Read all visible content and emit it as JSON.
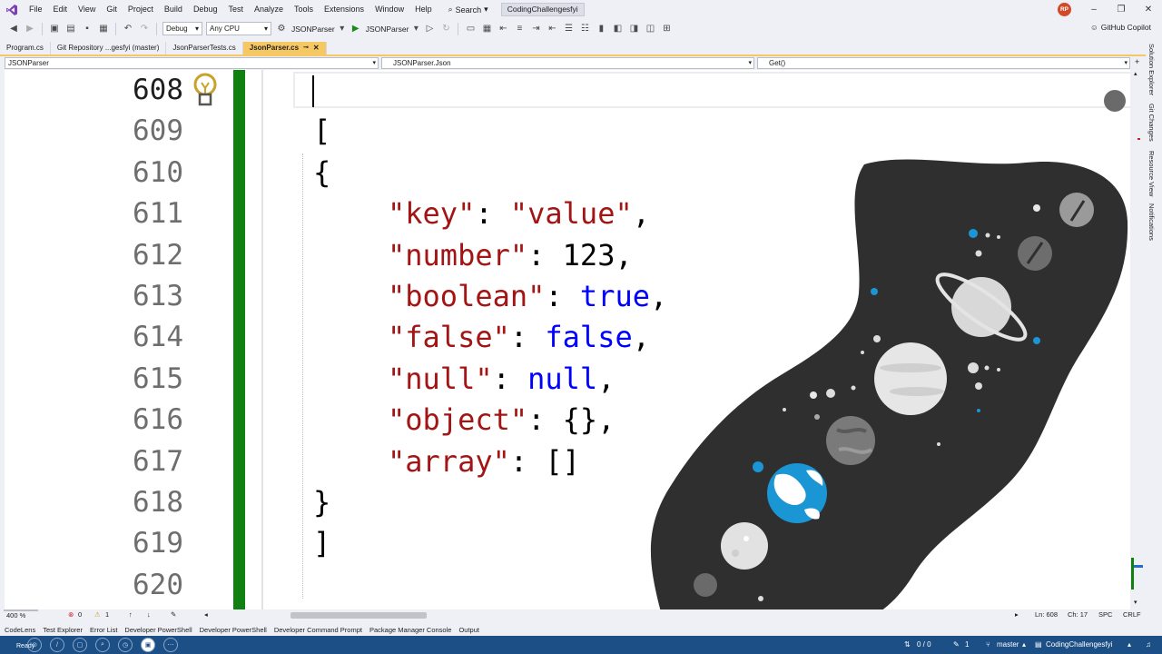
{
  "menu": {
    "items": [
      "File",
      "Edit",
      "View",
      "Git",
      "Project",
      "Build",
      "Debug",
      "Test",
      "Analyze",
      "Tools",
      "Extensions",
      "Window",
      "Help"
    ],
    "search_label": "Search",
    "solution_name": "CodingChallengesfyi",
    "avatar_initials": "RP"
  },
  "toolbar": {
    "config": "Debug",
    "platform": "Any CPU",
    "startup_project": "JSONParser",
    "run_label": "JSONParser",
    "copilot_label": "GitHub Copilot"
  },
  "tabs": [
    {
      "label": "Program.cs",
      "active": false
    },
    {
      "label": "Git Repository ...gesfyi (master)",
      "active": false
    },
    {
      "label": "JsonParserTests.cs",
      "active": false
    },
    {
      "label": "JsonParser.cs",
      "active": true
    }
  ],
  "navbar": {
    "project": "JSONParser",
    "type": "JSONParser.Json",
    "member": "Get()"
  },
  "editor": {
    "line_numbers": [
      "608",
      "609",
      "610",
      "611",
      "612",
      "613",
      "614",
      "615",
      "616",
      "617",
      "618",
      "619",
      "620"
    ],
    "lines": {
      "l609": "[",
      "l610": "{",
      "l611_key": "\"key\"",
      "l611_sep": ": ",
      "l611_val": "\"value\"",
      "l611_end": ",",
      "l612_key": "\"number\"",
      "l612_sep": ": ",
      "l612_val": "123",
      "l612_end": ",",
      "l613_key": "\"boolean\"",
      "l613_sep": ": ",
      "l613_val": "true",
      "l613_end": ",",
      "l614_key": "\"false\"",
      "l614_sep": ": ",
      "l614_val": "false",
      "l614_end": ",",
      "l615_key": "\"null\"",
      "l615_sep": ": ",
      "l615_val": "null",
      "l615_end": ",",
      "l616_key": "\"object\"",
      "l616_sep": ": ",
      "l616_val": "{},",
      "l617_key": "\"array\"",
      "l617_sep": ": ",
      "l617_val": "[]",
      "l618": "}",
      "l619": "]"
    }
  },
  "editor_status": {
    "zoom": "400 %",
    "errors": "0",
    "warnings": "1",
    "ln": "Ln: 608",
    "ch": "Ch: 17",
    "spc": "SPC",
    "eol": "CRLF"
  },
  "toolwindows": [
    "CodeLens",
    "Test Explorer",
    "Error List",
    "Developer PowerShell",
    "Developer PowerShell",
    "Developer Command Prompt",
    "Package Manager Console",
    "Output"
  ],
  "right_panel": [
    "Solution Explorer",
    "Git Changes",
    "Resource View",
    "Notifications"
  ],
  "statusbar": {
    "ready": "Ready",
    "sync": "0 / 0",
    "pencil": "1",
    "branch": "master",
    "repo": "CodingChallengesfyi"
  },
  "colors": {
    "string": "#a31515",
    "keyword": "#0000ff",
    "change_bar": "#108010",
    "active_tab": "#f6c863",
    "statusbar": "#1b4f86",
    "illustration_bg": "#2f2f2f",
    "planet_blue": "#1a96d4"
  }
}
